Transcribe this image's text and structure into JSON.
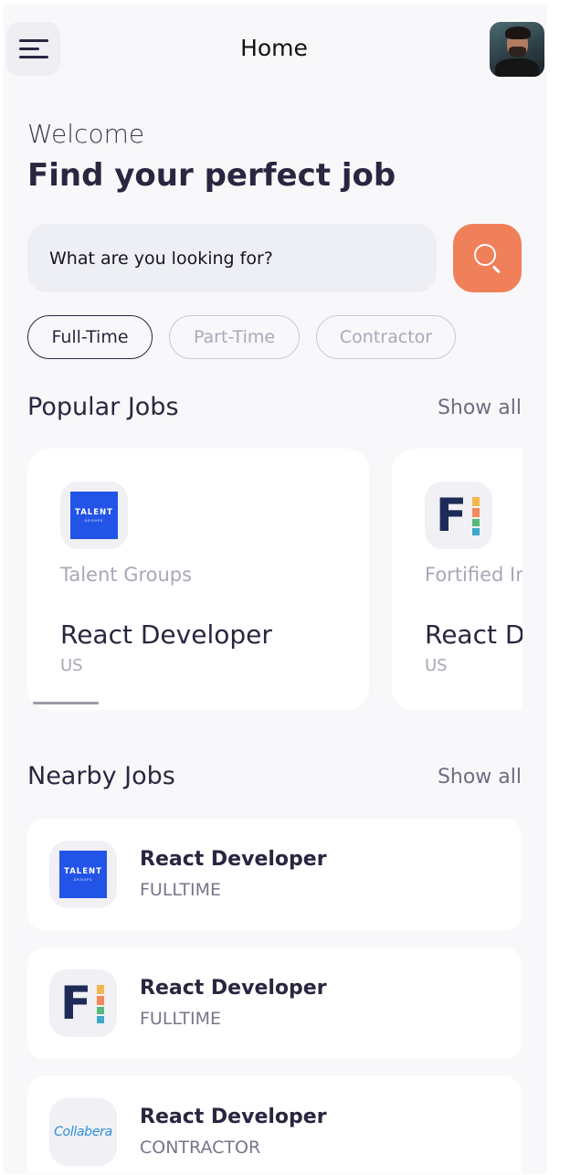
{
  "header": {
    "title": "Home",
    "menu_icon": "menu-icon",
    "avatar_icon": "avatar"
  },
  "welcome": {
    "greeting": "Welcome",
    "headline": "Find your perfect job"
  },
  "search": {
    "placeholder": "What are you looking for?",
    "button_icon": "search-icon"
  },
  "filters": [
    {
      "label": "Full-Time",
      "active": true
    },
    {
      "label": "Part-Time",
      "active": false
    },
    {
      "label": "Contractor",
      "active": false
    }
  ],
  "popular": {
    "title": "Popular Jobs",
    "show_all": "Show all",
    "jobs": [
      {
        "company": "Talent Groups",
        "title": "React Developer",
        "location": "US",
        "logo_text": "TALENT",
        "logo_sub": "GROUPS"
      },
      {
        "company": "Fortified Intelligence",
        "title": "React Developer",
        "location": "US",
        "logo_text": "F"
      }
    ]
  },
  "nearby": {
    "title": "Nearby Jobs",
    "show_all": "Show all",
    "jobs": [
      {
        "title": "React Developer",
        "type": "FULLTIME",
        "logo_text": "TALENT",
        "logo_sub": "GROUPS"
      },
      {
        "title": "React Developer",
        "type": "FULLTIME",
        "logo_text": "F"
      },
      {
        "title": "React Developer",
        "type": "CONTRACTOR",
        "logo_text": "Collabera"
      }
    ]
  },
  "colors": {
    "accent": "#f0805a",
    "primary_text": "#2a2640",
    "talent_blue": "#2354e8",
    "fortified_navy": "#1f2b57"
  }
}
